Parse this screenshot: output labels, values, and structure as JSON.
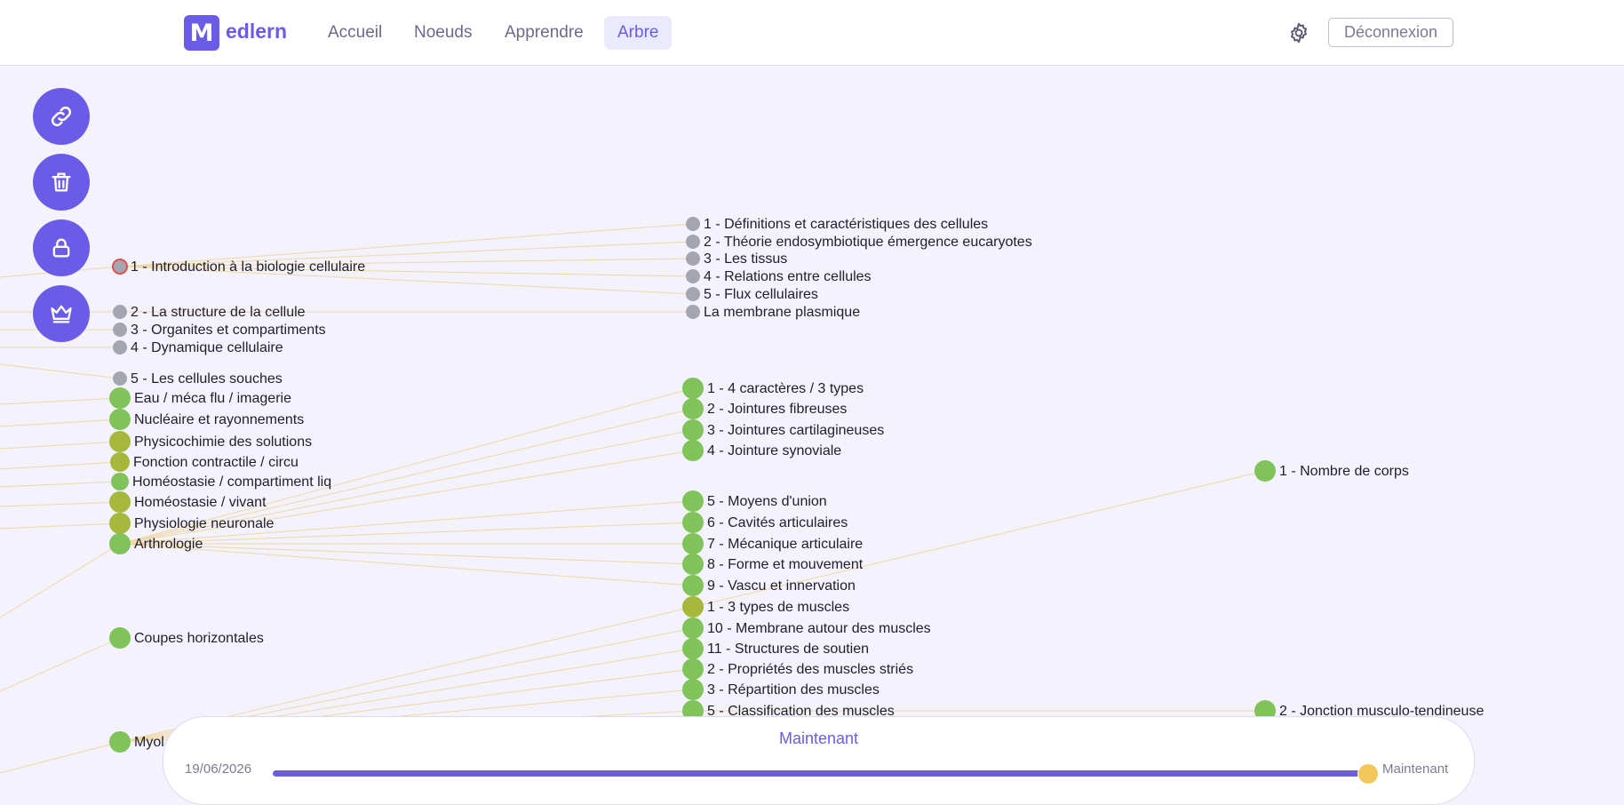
{
  "header": {
    "logo_letter": "M",
    "logo_text": "edlern",
    "nav": [
      "Accueil",
      "Noeuds",
      "Apprendre",
      "Arbre"
    ],
    "active_nav": "Arbre",
    "logout_label": "Déconnexion",
    "settings_icon": "gear-icon"
  },
  "sidebar_actions": [
    "link-icon",
    "trash-icon",
    "lock-icon",
    "crown-icon"
  ],
  "colors": {
    "accent": "#6b5ce7",
    "background": "#f3f2fd",
    "node_gray": "#a3a5b0",
    "node_green": "#7fc35a",
    "node_olive": "#a6b83c",
    "edge": "#f0d8a4",
    "selected_ring": "#e05050"
  },
  "tree": {
    "nodes": [
      {
        "id": "n1",
        "label": "1 - Introduction à la biologie cellulaire",
        "status": "gray",
        "selected": true
      },
      {
        "id": "n2",
        "label": "2 - La structure de la cellule",
        "status": "gray"
      },
      {
        "id": "n3",
        "label": "3 - Organites et compartiments",
        "status": "gray"
      },
      {
        "id": "n4",
        "label": "4 - Dynamique cellulaire",
        "status": "gray"
      },
      {
        "id": "n5",
        "label": "5 - Les cellules souches",
        "status": "gray"
      },
      {
        "id": "n6",
        "label": "Eau / méca flu / imagerie",
        "status": "green"
      },
      {
        "id": "n7",
        "label": "Nucléaire et rayonnements",
        "status": "green"
      },
      {
        "id": "n8",
        "label": "Physicochimie des solutions",
        "status": "olive"
      },
      {
        "id": "n9",
        "label": "Fonction contractile / circu",
        "status": "olive"
      },
      {
        "id": "n10",
        "label": "Homéostasie / compartiment liq",
        "status": "green"
      },
      {
        "id": "n11",
        "label": "Homéostasie / vivant",
        "status": "olive"
      },
      {
        "id": "n12",
        "label": "Physiologie neuronale",
        "status": "olive"
      },
      {
        "id": "n13",
        "label": "Arthrologie",
        "status": "green"
      },
      {
        "id": "n14",
        "label": "Coupes horizontales",
        "status": "green"
      },
      {
        "id": "n15",
        "label": "Myol",
        "status": "green"
      },
      {
        "id": "m1",
        "label": "1 - Définitions et caractéristiques des cellules",
        "status": "gray"
      },
      {
        "id": "m2",
        "label": "2 - Théorie endosymbiotique émergence eucaryotes",
        "status": "gray"
      },
      {
        "id": "m3",
        "label": "3 - Les tissus",
        "status": "gray"
      },
      {
        "id": "m4",
        "label": "4 - Relations entre cellules",
        "status": "gray"
      },
      {
        "id": "m5",
        "label": "5 - Flux cellulaires",
        "status": "gray"
      },
      {
        "id": "m6",
        "label": "La membrane plasmique",
        "status": "gray"
      },
      {
        "id": "m7",
        "label": "1 - 4 caractères / 3 types",
        "status": "green"
      },
      {
        "id": "m8",
        "label": "2 - Jointures fibreuses",
        "status": "green"
      },
      {
        "id": "m9",
        "label": "3 - Jointures cartilagineuses",
        "status": "green"
      },
      {
        "id": "m10",
        "label": "4 - Jointure synoviale",
        "status": "green"
      },
      {
        "id": "m11",
        "label": "5 - Moyens d'union",
        "status": "green"
      },
      {
        "id": "m12",
        "label": "6 - Cavités articulaires",
        "status": "green"
      },
      {
        "id": "m13",
        "label": "7 - Mécanique articulaire",
        "status": "green"
      },
      {
        "id": "m14",
        "label": "8 - Forme et mouvement",
        "status": "green"
      },
      {
        "id": "m15",
        "label": "9 - Vascu et innervation",
        "status": "green"
      },
      {
        "id": "m16",
        "label": "1 - 3 types de muscles",
        "status": "olive"
      },
      {
        "id": "m17",
        "label": "10 - Membrane autour des muscles",
        "status": "green"
      },
      {
        "id": "m18",
        "label": "11 - Structures de soutien",
        "status": "green"
      },
      {
        "id": "m19",
        "label": "2 - Propriétés des muscles striés",
        "status": "green"
      },
      {
        "id": "m20",
        "label": "3 - Répartition des muscles",
        "status": "green"
      },
      {
        "id": "m21",
        "label": "5 - Classification des muscles",
        "status": "green"
      },
      {
        "id": "r1",
        "label": "1 - Nombre de corps",
        "status": "green"
      },
      {
        "id": "r2",
        "label": "2 - Jonction musculo-tendineuse",
        "status": "green"
      }
    ],
    "edges": [
      [
        "n1",
        "m1"
      ],
      [
        "n1",
        "m2"
      ],
      [
        "n1",
        "m3"
      ],
      [
        "n1",
        "m4"
      ],
      [
        "n1",
        "m5"
      ],
      [
        "n2",
        "m6"
      ],
      [
        "n13",
        "m7"
      ],
      [
        "n13",
        "m8"
      ],
      [
        "n13",
        "m9"
      ],
      [
        "n13",
        "m10"
      ],
      [
        "n13",
        "m11"
      ],
      [
        "n13",
        "m12"
      ],
      [
        "n13",
        "m13"
      ],
      [
        "n13",
        "m14"
      ],
      [
        "n13",
        "m15"
      ],
      [
        "n15",
        "m16"
      ],
      [
        "n15",
        "m17"
      ],
      [
        "n15",
        "m18"
      ],
      [
        "n15",
        "m19"
      ],
      [
        "n15",
        "m20"
      ],
      [
        "n15",
        "m21"
      ],
      [
        "m16",
        "r1"
      ],
      [
        "m21",
        "r2"
      ]
    ]
  },
  "timeline": {
    "title": "Maintenant",
    "start_label": "19/06/2026",
    "end_label": "Maintenant",
    "position": 1.0
  }
}
